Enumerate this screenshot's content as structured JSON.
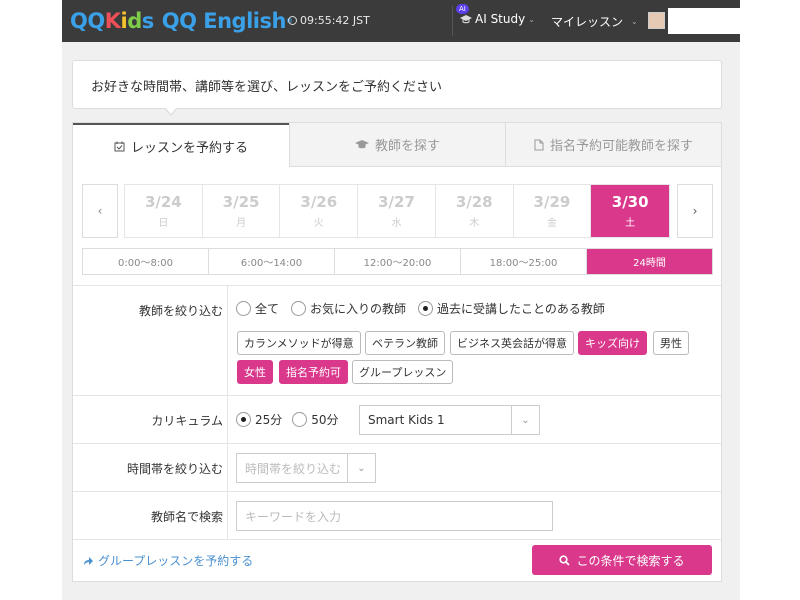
{
  "header": {
    "logo_qq": "QQ",
    "logo_kids": [
      "K",
      "i",
      "d",
      "s"
    ],
    "logo_english": "QQ English",
    "logo_reg": "®",
    "clock": "09:55:42 JST",
    "ai_badge": "AI",
    "ai_study": "AI Study",
    "my_lesson": "マイレッスン",
    "caret": "⌄"
  },
  "bubble_text": "お好きな時間帯、講師等を選び、レッスンをご予約ください",
  "tabs": [
    {
      "label": "レッスンを予約する",
      "icon": "calendar-check-icon"
    },
    {
      "label": "教師を探す",
      "icon": "graduation-cap-icon"
    },
    {
      "label": "指名予約可能教師を探す",
      "icon": "document-icon"
    }
  ],
  "dates": [
    {
      "date": "3/24",
      "weekday": "日"
    },
    {
      "date": "3/25",
      "weekday": "月"
    },
    {
      "date": "3/26",
      "weekday": "火"
    },
    {
      "date": "3/27",
      "weekday": "水"
    },
    {
      "date": "3/28",
      "weekday": "木"
    },
    {
      "date": "3/29",
      "weekday": "金"
    },
    {
      "date": "3/30",
      "weekday": "土"
    }
  ],
  "selected_date": "3/30",
  "nav": {
    "prev": "‹",
    "next": "›"
  },
  "times": [
    "0:00〜8:00",
    "6:00〜14:00",
    "12:00〜20:00",
    "18:00〜25:00",
    "24時間"
  ],
  "selected_time": "24時間",
  "filter_teacher": {
    "label": "教師を絞り込む",
    "options": [
      "全て",
      "お気に入りの教師",
      "過去に受講したことのある教師"
    ],
    "selected": "過去に受講したことのある教師",
    "tags": [
      {
        "label": "カランメソッドが得意",
        "on": false
      },
      {
        "label": "ベテラン教師",
        "on": false
      },
      {
        "label": "ビジネス英会話が得意",
        "on": false
      },
      {
        "label": "キッズ向け",
        "on": true
      },
      {
        "label": "男性",
        "on": false
      },
      {
        "label": "女性",
        "on": true
      },
      {
        "label": "指名予約可",
        "on": true
      },
      {
        "label": "グループレッスン",
        "on": false
      }
    ]
  },
  "curriculum": {
    "label": "カリキュラム",
    "options": [
      "25分",
      "50分"
    ],
    "selected": "25分",
    "course": "Smart Kids 1"
  },
  "time_filter": {
    "label": "時間帯を絞り込む",
    "placeholder": "時間帯を絞り込む"
  },
  "teacher_search": {
    "label": "教師名で検索",
    "placeholder": "キーワードを入力"
  },
  "group_link": "グループレッスンを予約する",
  "search_button": "この条件で検索する",
  "colors": {
    "accent": "#d9388b",
    "header": "#3b3b3b",
    "link": "#4a90d0"
  }
}
